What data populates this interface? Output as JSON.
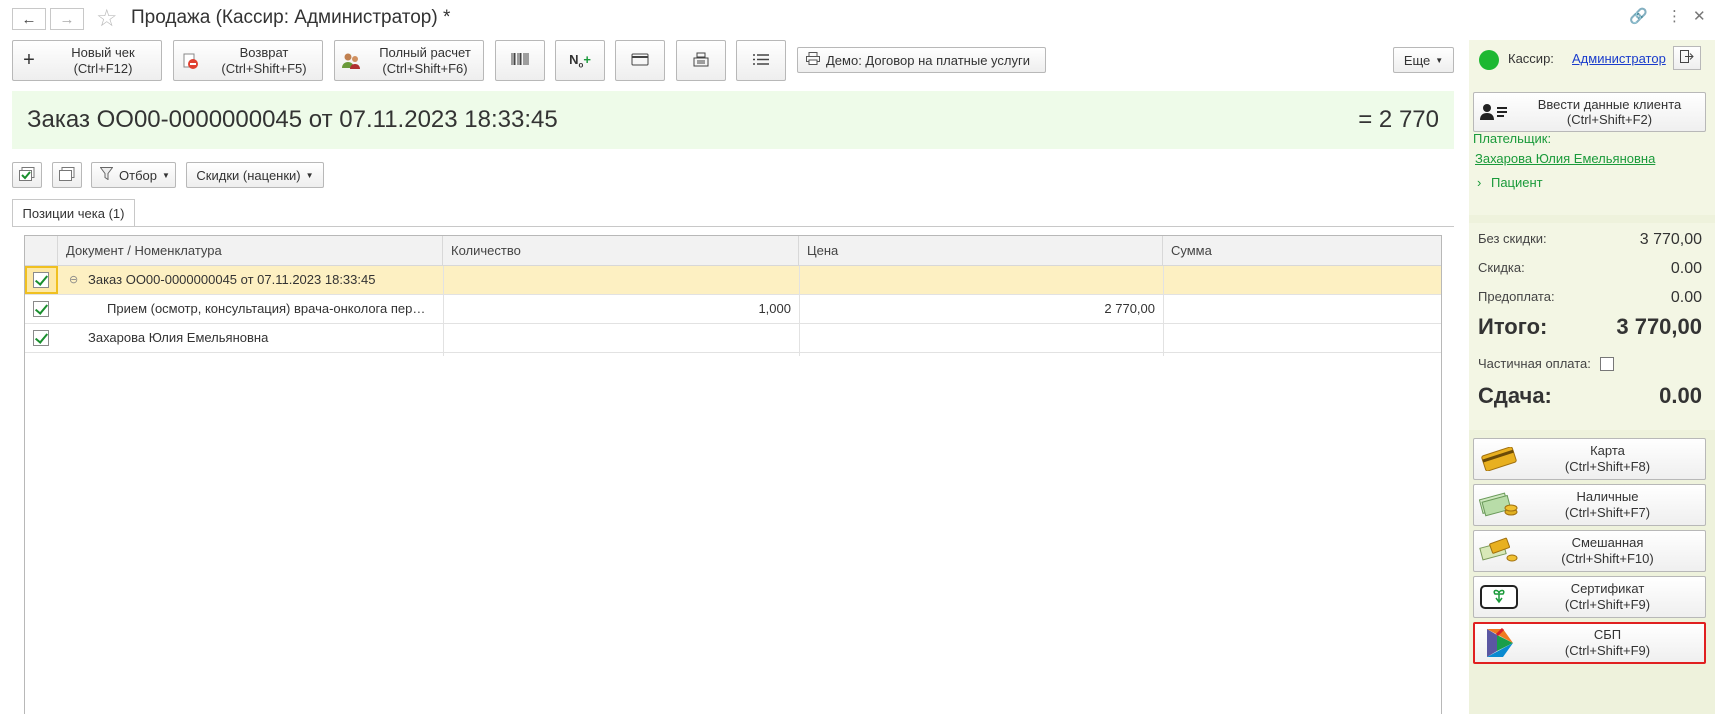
{
  "window": {
    "title": "Продажа (Кассир: Администратор) *"
  },
  "toolbar": {
    "new_check": "Новый чек\n(Ctrl+F12)",
    "return": "Возврат\n(Ctrl+Shift+F5)",
    "full_payment": "Полный расчет\n(Ctrl+Shift+F6)",
    "print_contract": "Демо: Договор на платные услуги",
    "more": "Еще"
  },
  "cashier": {
    "label": "Кассир:",
    "name": "Администратор"
  },
  "order": {
    "title": "Заказ ОО00-0000000045 от 07.11.2023 18:33:45",
    "total": "= 2 770"
  },
  "subtoolbar": {
    "filter": "Отбор",
    "discounts": "Скидки (наценки)"
  },
  "tabs": [
    {
      "label": "Позиции чека (1)"
    }
  ],
  "table": {
    "columns": [
      "Документ / Номенклатура",
      "Количество",
      "Цена",
      "Сумма"
    ],
    "rows": [
      {
        "name": "Заказ ОО00-0000000045 от 07.11.2023 18:33:45",
        "qty": "",
        "price": "",
        "sum": ""
      },
      {
        "name": "Прием (осмотр, консультация) врача-онколога пер…",
        "qty": "1,000",
        "price": "2 770,00",
        "sum": ""
      },
      {
        "name": "Захарова Юлия Емельяновна",
        "qty": "",
        "price": "",
        "sum": ""
      }
    ]
  },
  "client": {
    "enter_button": "Ввести данные клиента\n(Ctrl+Shift+F2)",
    "payer_label": "Плательщик:",
    "payer_name": "Захарова Юлия Емельяновна",
    "patient_label": "Пациент"
  },
  "summary": {
    "no_discount_label": "Без скидки:",
    "no_discount_value": "3 770,00",
    "discount_label": "Скидка:",
    "discount_value": "0.00",
    "prepay_label": "Предоплата:",
    "prepay_value": "0.00",
    "total_label": "Итого:",
    "total_value": "3 770,00",
    "partial_label": "Частичная оплата:",
    "change_label": "Сдача:",
    "change_value": "0.00"
  },
  "payments": [
    {
      "label": "Карта\n(Ctrl+Shift+F8)"
    },
    {
      "label": "Наличные\n(Ctrl+Shift+F7)"
    },
    {
      "label": "Смешанная\n(Ctrl+Shift+F10)"
    },
    {
      "label": "Сертификат\n(Ctrl+Shift+F9)"
    },
    {
      "label": "СБП\n(Ctrl+Shift+F9)"
    }
  ],
  "colors": {
    "banner_bg": "#eefbe9",
    "panel_bg": "#eef2dc",
    "highlight_row": "#fdf0c2",
    "selected_border": "#e02020",
    "online": "#1db832"
  }
}
